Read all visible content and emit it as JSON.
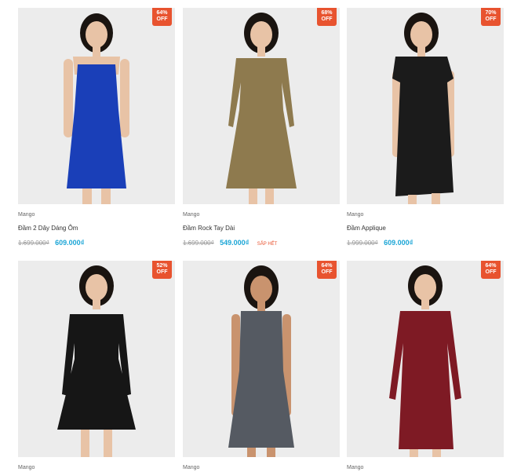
{
  "products": [
    {
      "discount_pct": "64%",
      "discount_word": "OFF",
      "brand": "Mango",
      "title": "Đầm 2 Dây Dáng Ôm",
      "old_price": "1.699.000₫",
      "new_price": "609.000₫",
      "stock_note": "",
      "dress_color": "#1a3fb8",
      "image": "model-blue-strap-dress"
    },
    {
      "discount_pct": "68%",
      "discount_word": "OFF",
      "brand": "Mango",
      "title": "Đầm Rock Tay Dài",
      "old_price": "1.699.000₫",
      "new_price": "549.000₫",
      "stock_note": "SẮP HẾT",
      "dress_color": "#8e7a4e",
      "image": "model-leopard-longsleeve-dress"
    },
    {
      "discount_pct": "70%",
      "discount_word": "OFF",
      "brand": "Mango",
      "title": "Đầm Applique",
      "old_price": "1.999.000₫",
      "new_price": "609.000₫",
      "stock_note": "",
      "dress_color": "#1b1b1b",
      "image": "model-black-shift-dress"
    },
    {
      "discount_pct": "52%",
      "discount_word": "OFF",
      "brand": "Mango",
      "dress_color": "#161616",
      "image": "model-black-skater-dress"
    },
    {
      "discount_pct": "64%",
      "discount_word": "OFF",
      "brand": "Mango",
      "dress_color": "#555a62",
      "image": "model-grey-pleated-dress"
    },
    {
      "discount_pct": "64%",
      "discount_word": "OFF",
      "brand": "Mango",
      "dress_color": "#7e1a24",
      "image": "model-burgundy-bodycon-dress"
    }
  ]
}
